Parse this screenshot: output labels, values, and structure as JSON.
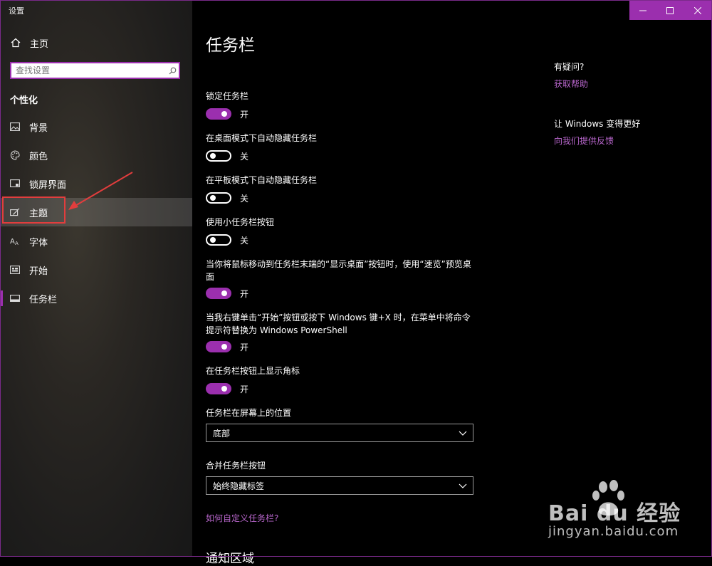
{
  "window": {
    "title": "设置",
    "accent_color": "#9b2fae",
    "highlight_color": "#e23d3d"
  },
  "titlebar": {
    "minimize_icon": "minimize-icon",
    "maximize_icon": "maximize-icon",
    "close_icon": "close-icon"
  },
  "sidebar": {
    "home_label": "主页",
    "search_placeholder": "查找设置",
    "section_title": "个性化",
    "items": [
      {
        "label": "背景",
        "icon": "image-icon"
      },
      {
        "label": "颜色",
        "icon": "palette-icon"
      },
      {
        "label": "锁屏界面",
        "icon": "lock-screen-icon"
      },
      {
        "label": "主题",
        "icon": "theme-brush-icon"
      },
      {
        "label": "字体",
        "icon": "font-icon"
      },
      {
        "label": "开始",
        "icon": "start-icon"
      },
      {
        "label": "任务栏",
        "icon": "taskbar-icon"
      }
    ]
  },
  "main": {
    "title": "任务栏",
    "settings": [
      {
        "label": "锁定任务栏",
        "state": "开"
      },
      {
        "label": "在桌面模式下自动隐藏任务栏",
        "state": "关"
      },
      {
        "label": "在平板模式下自动隐藏任务栏",
        "state": "关"
      },
      {
        "label": "使用小任务栏按钮",
        "state": "关"
      },
      {
        "label": "当你将鼠标移动到任务栏末端的“显示桌面”按钮时，使用“速览”预览桌面",
        "state": "开"
      },
      {
        "label": "当我右键单击“开始”按钮或按下 Windows 键+X 时，在菜单中将命令提示符替换为 Windows PowerShell",
        "state": "开"
      },
      {
        "label": "在任务栏按钮上显示角标",
        "state": "开"
      }
    ],
    "position": {
      "label": "任务栏在屏幕上的位置",
      "value": "底部"
    },
    "combine": {
      "label": "合并任务栏按钮",
      "value": "始终隐藏标签"
    },
    "help_link": "如何自定义任务栏?",
    "next_section": "通知区域"
  },
  "right": {
    "question_title": "有疑问?",
    "get_help": "获取帮助",
    "improve_title": "让 Windows 变得更好",
    "feedback": "向我们提供反馈"
  },
  "watermark": {
    "brand": "Bai du 经验",
    "url": "jingyan.baidu.com"
  }
}
